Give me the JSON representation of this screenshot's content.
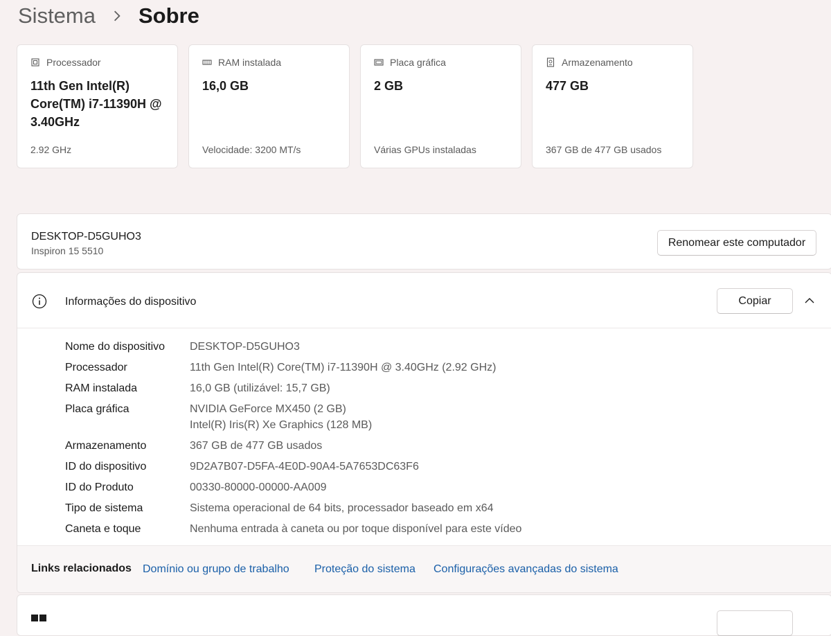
{
  "breadcrumb": {
    "parent": "Sistema",
    "current": "Sobre"
  },
  "cards": [
    {
      "icon": "processor-icon",
      "label": "Processador",
      "value": "11th Gen Intel(R) Core(TM) i7-11390H @ 3.40GHz",
      "sub": "2.92 GHz"
    },
    {
      "icon": "ram-icon",
      "label": "RAM instalada",
      "value": "16,0 GB",
      "sub": "Velocidade: 3200 MT/s"
    },
    {
      "icon": "gpu-icon",
      "label": "Placa gráfica",
      "value": "2 GB",
      "sub": "Várias GPUs instaladas"
    },
    {
      "icon": "storage-icon",
      "label": "Armazenamento",
      "value": "477 GB",
      "sub": "367 GB de 477 GB usados"
    }
  ],
  "device": {
    "name": "DESKTOP-D5GUHO3",
    "model": "Inspiron 15 5510",
    "rename_label": "Renomear este computador"
  },
  "info": {
    "title": "Informações do dispositivo",
    "copy_label": "Copiar",
    "specs": [
      {
        "label": "Nome do dispositivo",
        "values": [
          "DESKTOP-D5GUHO3"
        ]
      },
      {
        "label": "Processador",
        "values": [
          "11th Gen Intel(R) Core(TM) i7-11390H @ 3.40GHz (2.92 GHz)"
        ]
      },
      {
        "label": "RAM instalada",
        "values": [
          "16,0 GB (utilizável: 15,7 GB)"
        ]
      },
      {
        "label": "Placa gráfica",
        "values": [
          "NVIDIA GeForce MX450 (2 GB)",
          "Intel(R) Iris(R) Xe Graphics (128 MB)"
        ]
      },
      {
        "label": "Armazenamento",
        "values": [
          "367 GB de 477 GB usados"
        ]
      },
      {
        "label": "ID do dispositivo",
        "values": [
          "9D2A7B07-D5FA-4E0D-90A4-5A7653DC63F6"
        ]
      },
      {
        "label": "ID do Produto",
        "values": [
          "00330-80000-00000-AA009"
        ]
      },
      {
        "label": "Tipo de sistema",
        "values": [
          "Sistema operacional de 64 bits, processador baseado em x64"
        ]
      },
      {
        "label": "Caneta e toque",
        "values": [
          "Nenhuma entrada à caneta ou por toque disponível para este vídeo"
        ]
      }
    ]
  },
  "links": {
    "label": "Links relacionados",
    "items": [
      "Domínio ou grupo de trabalho",
      "Proteção do sistema",
      "Configurações avançadas do sistema"
    ]
  },
  "colors": {
    "link": "#1a5fa8",
    "background": "#f7f1f1",
    "card": "#ffffff"
  }
}
